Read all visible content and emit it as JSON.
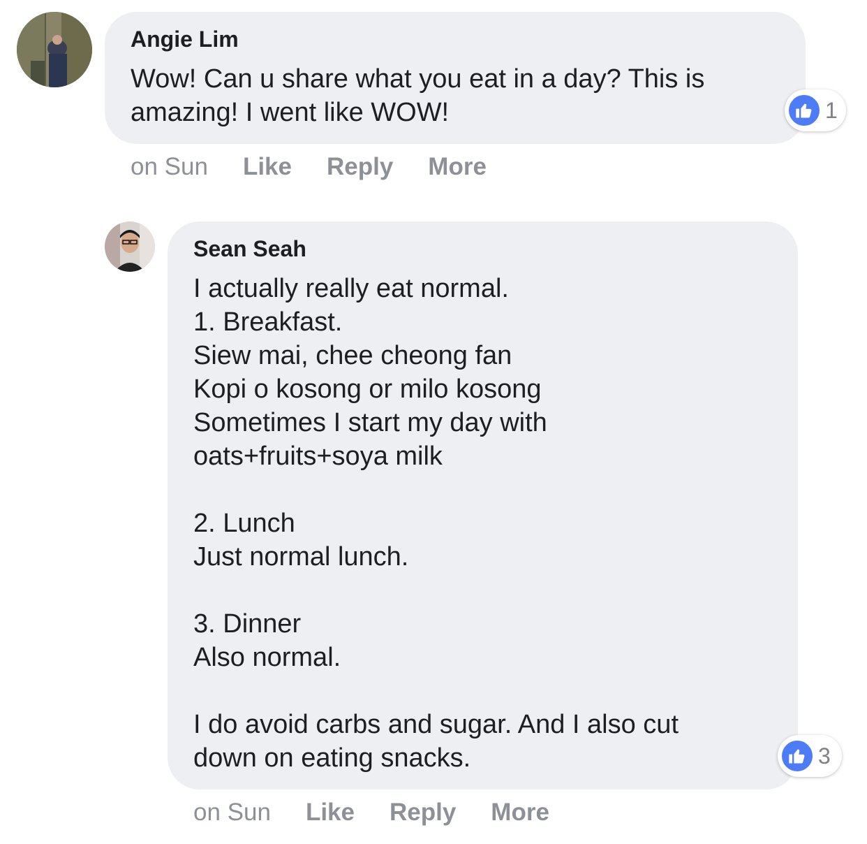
{
  "comments": [
    {
      "author": "Angie Lim",
      "text": "Wow! Can u share what you eat in a day? This is amazing! I went like WOW!",
      "reaction": {
        "icon": "thumbs-up-icon",
        "count": "1",
        "color": "#4d7cf6"
      },
      "actions": {
        "time": "on Sun",
        "like": "Like",
        "reply": "Reply",
        "more": "More"
      }
    },
    {
      "author": "Sean Seah",
      "text": "I actually really eat normal.\n1. Breakfast.\nSiew mai, chee cheong fan\nKopi o kosong or milo kosong\nSometimes I start my day with\noats+fruits+soya milk\n\n2. Lunch\nJust normal lunch.\n\n3. Dinner\nAlso normal.\n\nI do avoid carbs and sugar. And I also cut\ndown on eating snacks.",
      "reaction": {
        "icon": "thumbs-up-icon",
        "count": "3",
        "color": "#4d7cf6"
      },
      "actions": {
        "time": "on Sun",
        "like": "Like",
        "reply": "Reply",
        "more": "More"
      }
    }
  ],
  "colors": {
    "bubble": "#eeeff3",
    "action_text": "#8d9096",
    "like_blue": "#4d7cf6"
  }
}
